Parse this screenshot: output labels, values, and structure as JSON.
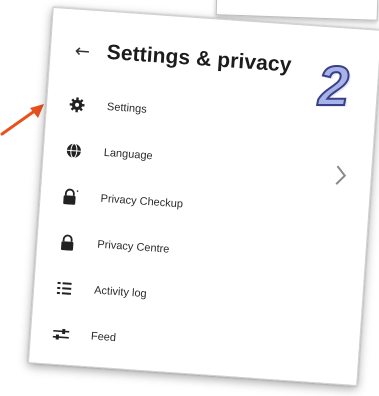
{
  "header": {
    "back_symbol": "←",
    "title": "Settings & privacy"
  },
  "menu": [
    {
      "label": "Settings",
      "icon": "gear-icon"
    },
    {
      "label": "Language",
      "icon": "globe-icon"
    },
    {
      "label": "Privacy Checkup",
      "icon": "lock-heart-icon"
    },
    {
      "label": "Privacy Centre",
      "icon": "lock-icon"
    },
    {
      "label": "Activity log",
      "icon": "list-icon"
    },
    {
      "label": "Feed",
      "icon": "sliders-icon"
    }
  ],
  "annotation": {
    "step_number": "2",
    "step_color": "#a6b4ea",
    "arrow_color": "#e8501c"
  },
  "colors": {
    "text": "#2b2b2b",
    "icon": "#222222"
  }
}
